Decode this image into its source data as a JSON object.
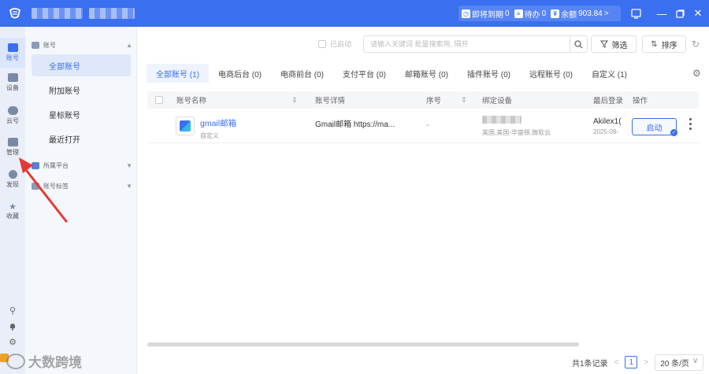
{
  "titlebar": {
    "status": {
      "expiring_label": "即将到期",
      "expiring_count": "0",
      "pending_label": "待办",
      "pending_count": "0",
      "balance_label": "余额",
      "balance_value": "903.84",
      "chevron": ">"
    },
    "icons": [
      "status-clock-icon",
      "pending-icon",
      "wallet-icon",
      "notification-icon",
      "minimize-icon",
      "maximize-icon",
      "close-icon"
    ]
  },
  "rail": {
    "items": [
      {
        "label": "账号",
        "icon": "account-icon",
        "active": true
      },
      {
        "label": "设备",
        "icon": "device-icon",
        "active": false
      },
      {
        "label": "云号",
        "icon": "cloud-icon",
        "active": false
      },
      {
        "label": "管理",
        "icon": "manage-icon",
        "active": false
      },
      {
        "label": "发现",
        "icon": "discover-icon",
        "active": false
      },
      {
        "label": "收藏",
        "icon": "star-icon",
        "active": false
      }
    ],
    "bottom_icons": [
      "pin-icon",
      "bell-icon",
      "settings-icon"
    ]
  },
  "sidebar": {
    "group_account": "账号",
    "items": [
      {
        "label": "全部账号",
        "active": true
      },
      {
        "label": "附加账号",
        "active": false
      },
      {
        "label": "星标账号",
        "active": false
      },
      {
        "label": "最近打开",
        "active": false
      }
    ],
    "group_platform": "所属平台",
    "group_tags": "账号标签"
  },
  "toolbar": {
    "launched_label": "已启动",
    "search_placeholder": "请输入关键词 批量搜索用, 隔开",
    "filter_label": "筛选",
    "sort_label": "排序"
  },
  "tabs": [
    {
      "label": "全部账号 (1)",
      "active": true
    },
    {
      "label": "电商后台 (0)",
      "active": false
    },
    {
      "label": "电商前台 (0)",
      "active": false
    },
    {
      "label": "支付平台 (0)",
      "active": false
    },
    {
      "label": "邮箱账号 (0)",
      "active": false
    },
    {
      "label": "插件账号 (0)",
      "active": false
    },
    {
      "label": "远程账号 (0)",
      "active": false
    },
    {
      "label": "自定义 (1)",
      "active": false
    }
  ],
  "table": {
    "columns": [
      "账号名称",
      "账号详情",
      "序号",
      "绑定设备",
      "最后登录",
      "操作"
    ],
    "rows": [
      {
        "name": "gmail邮箱",
        "name_sub": "自定义",
        "detail": "Gmail邮箱 https://ma...",
        "index": "-",
        "device_sub": "美国,美国-华盛顿,微软云",
        "last_login": "Akilex1(",
        "last_login_date": "2025-09-",
        "action": "启动"
      }
    ]
  },
  "pager": {
    "total": "共1条记录",
    "prev": "<",
    "page": "1",
    "next": ">",
    "page_size": "20 条/页",
    "size_caret": "∨"
  },
  "watermark": "大数跨境"
}
